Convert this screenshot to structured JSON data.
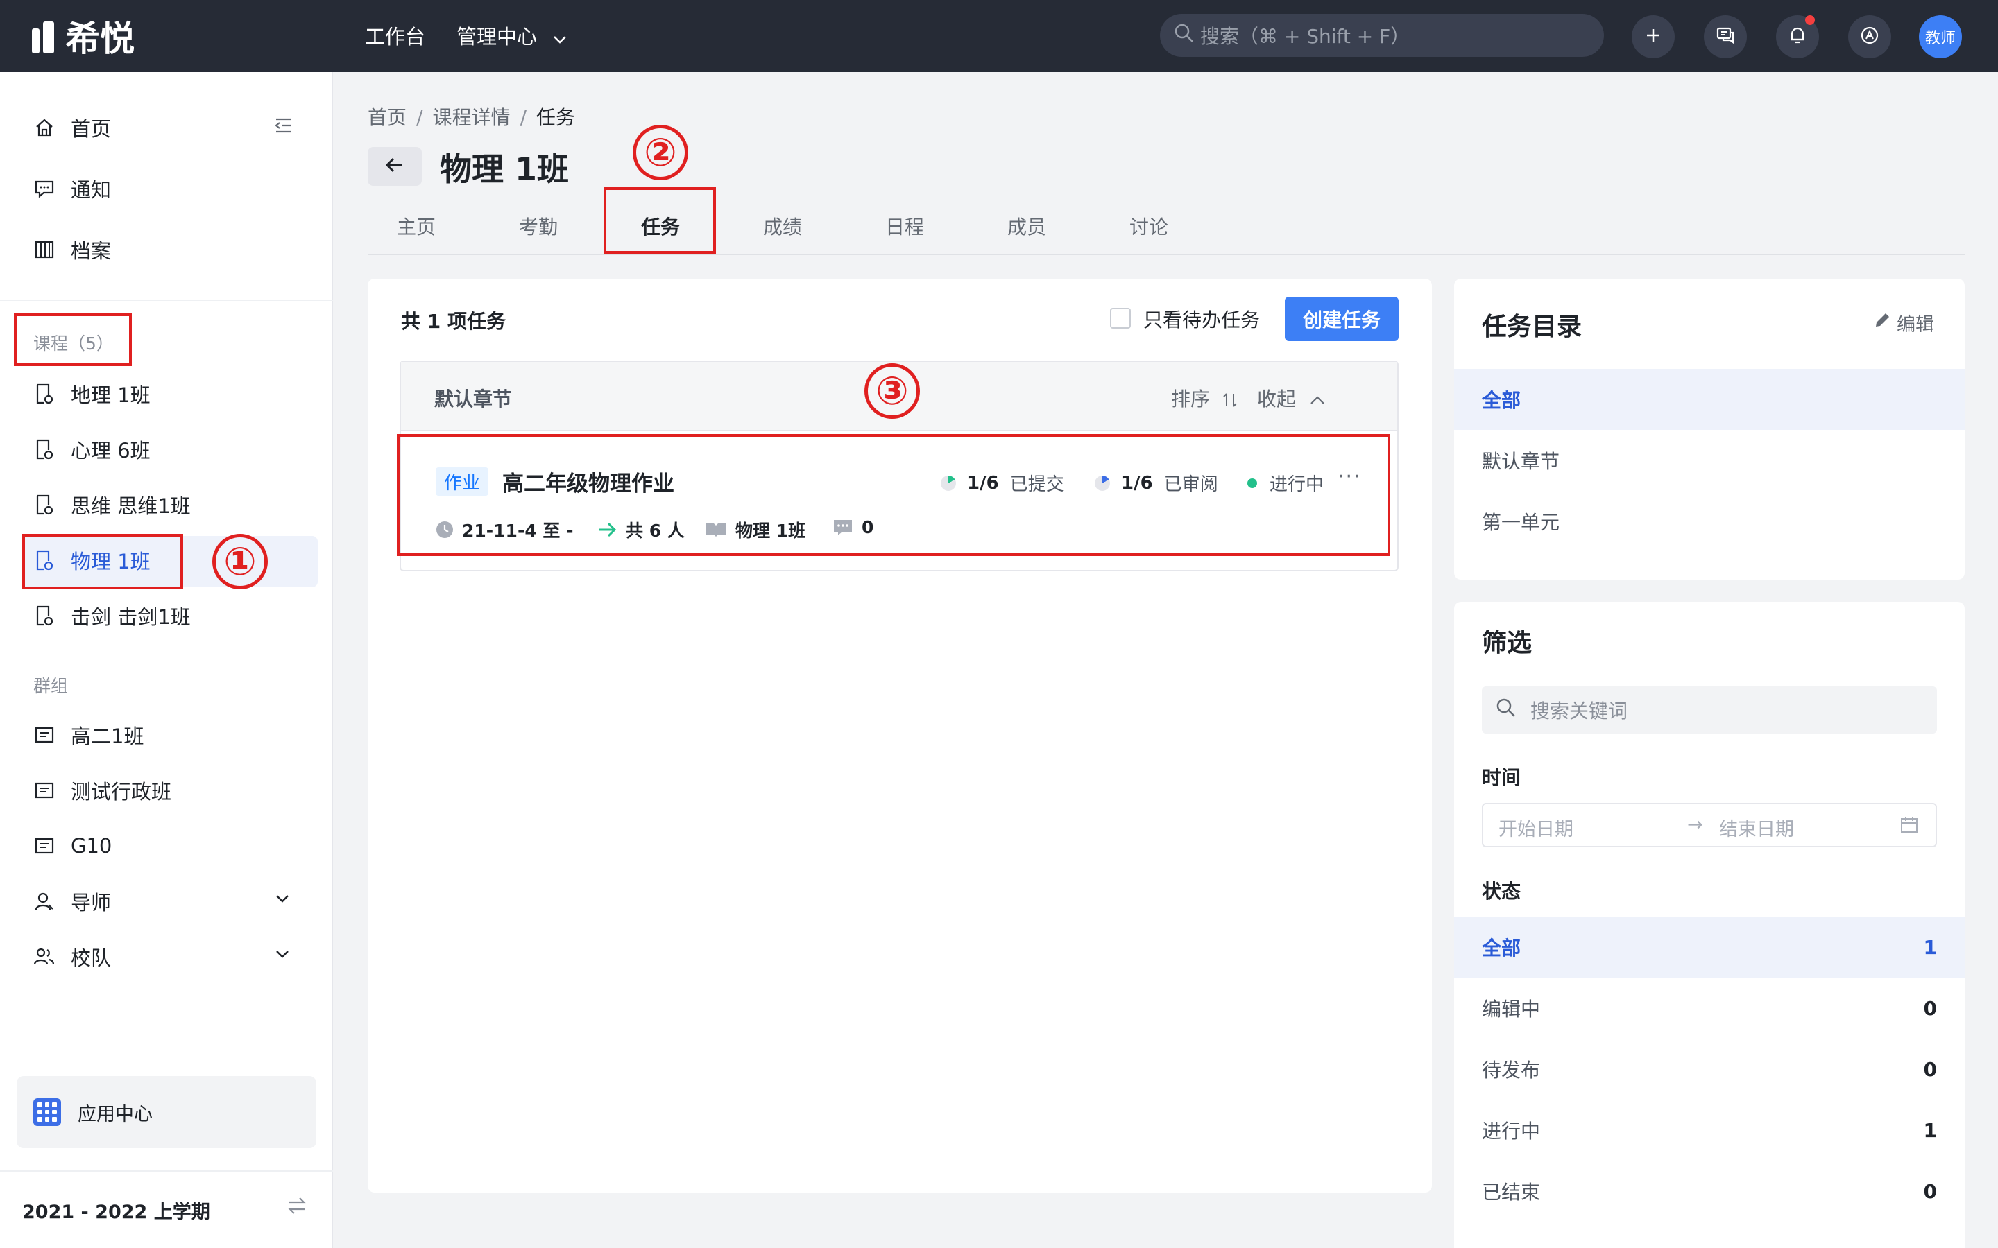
{
  "topbar": {
    "logo_text": "希悦",
    "nav_workbench": "工作台",
    "nav_admin": "管理中心",
    "search_placeholder": "搜索（⌘ + Shift + F）",
    "avatar_text": "教师"
  },
  "sidebar": {
    "home": "首页",
    "notice": "通知",
    "archive": "档案",
    "courses_header": "课程（5）",
    "courses": [
      "地理 1班",
      "心理 6班",
      "思维 思维1班",
      "物理 1班",
      "击剑 击剑1班"
    ],
    "groups_header": "群组",
    "groups": [
      "高二1班",
      "测试行政班",
      "G10"
    ],
    "mentor": "导师",
    "school_team": "校队",
    "app_center": "应用中心",
    "term": "2021 - 2022 上学期"
  },
  "header": {
    "breadcrumb": [
      "首页",
      "课程详情",
      "任务"
    ],
    "breadcrumb_sep": "/",
    "title": "物理 1班",
    "tabs": [
      "主页",
      "考勤",
      "任务",
      "成绩",
      "日程",
      "成员",
      "讨论"
    ]
  },
  "main": {
    "count_text": "共 1 项任务",
    "only_todo_label": "只看待办任务",
    "create_button": "创建任务",
    "section_title": "默认章节",
    "sort_label": "排序",
    "fold_label": "收起",
    "task": {
      "tag": "作业",
      "name": "高二年级物理作业",
      "submitted_count": "1/6",
      "submitted_label": "已提交",
      "reviewed_count": "1/6",
      "reviewed_label": "已审阅",
      "status": "进行中",
      "more": "···",
      "date": "21-11-4 至 -",
      "people": "共 6 人",
      "course": "物理 1班",
      "comments": "0"
    }
  },
  "toc": {
    "title": "任务目录",
    "edit": "编辑",
    "items": [
      "全部",
      "默认章节",
      "第一单元"
    ]
  },
  "filter": {
    "title": "筛选",
    "search_placeholder": "搜索关键词",
    "time_label": "时间",
    "start_date": "开始日期",
    "arrow": "→",
    "end_date": "结束日期",
    "status_label": "状态",
    "statuses": [
      {
        "label": "全部",
        "count": "1"
      },
      {
        "label": "编辑中",
        "count": "0"
      },
      {
        "label": "待发布",
        "count": "0"
      },
      {
        "label": "进行中",
        "count": "1"
      },
      {
        "label": "已结束",
        "count": "0"
      }
    ]
  },
  "annotations": [
    "①",
    "②",
    "③"
  ],
  "colors": {
    "topbar": "#262b36",
    "accent": "#3d7ff5",
    "annotation_red": "#e02020",
    "status_green": "#23c08b"
  }
}
